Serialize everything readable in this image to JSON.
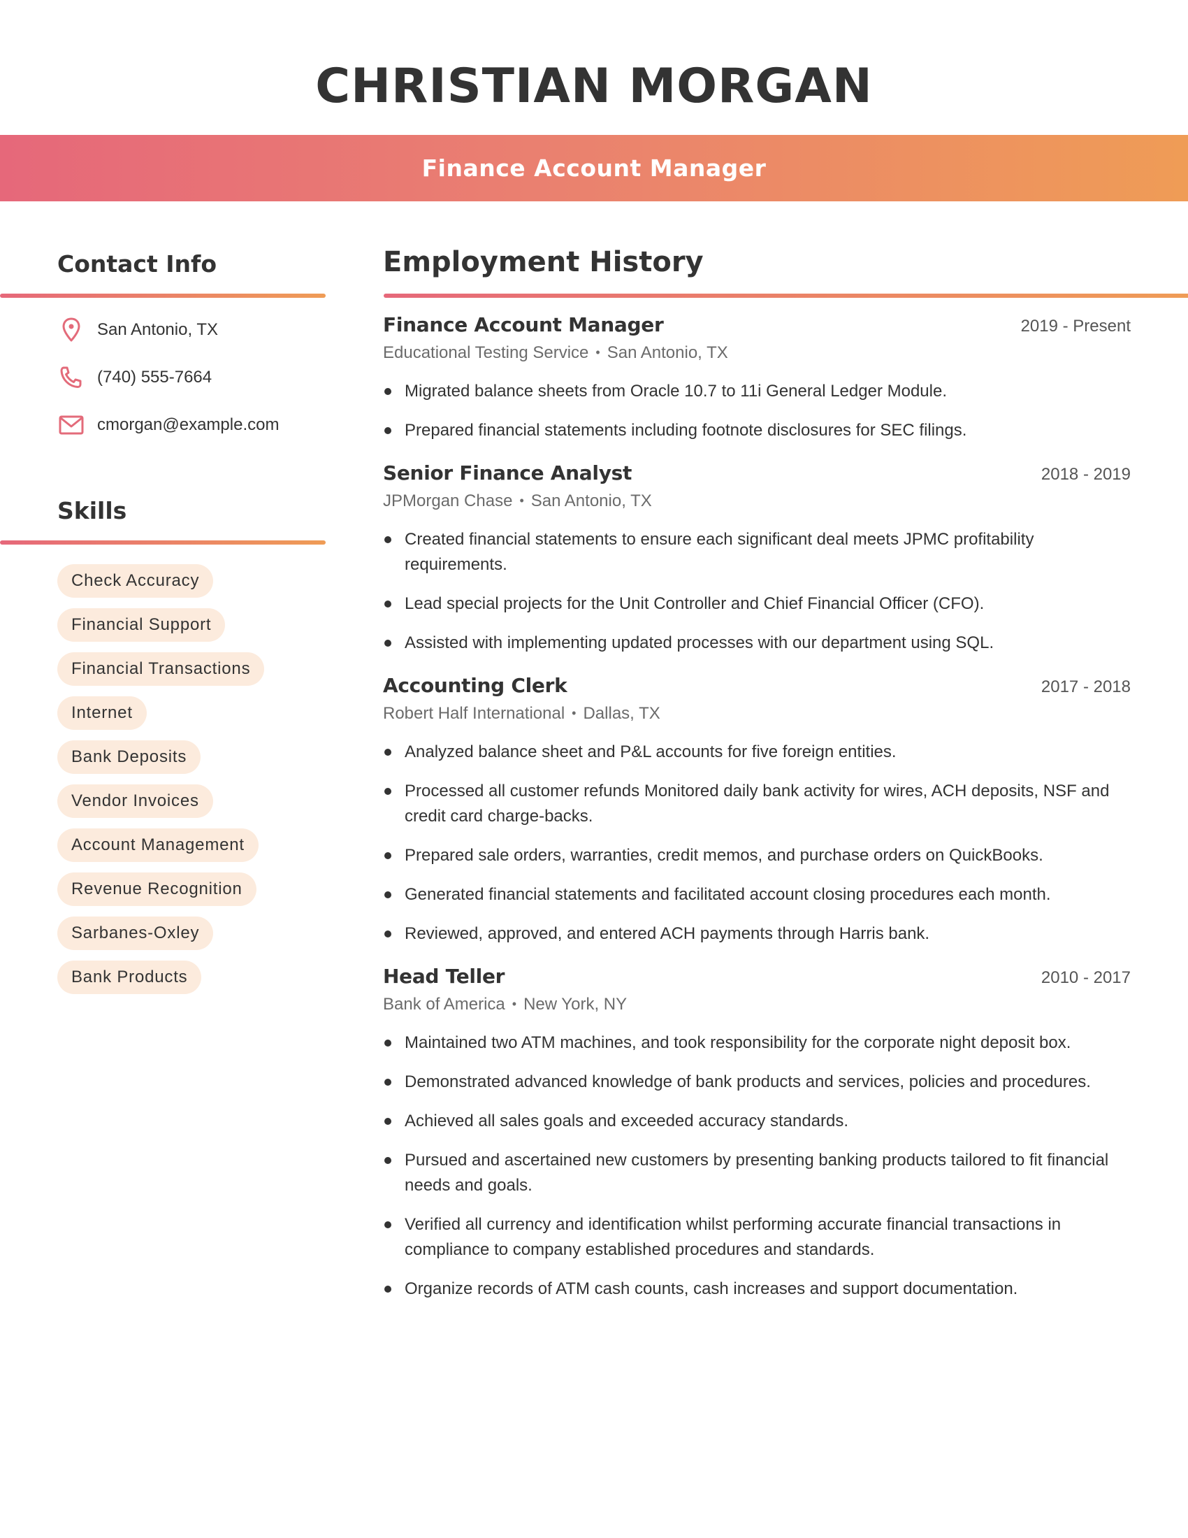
{
  "header": {
    "name": "CHRISTIAN MORGAN",
    "title": "Finance Account Manager"
  },
  "colors": {
    "gradient_start": "#e6687a",
    "gradient_end": "#ef9c56",
    "icon": "#e36b7a",
    "pill_bg": "#fcebdd",
    "text": "#333333"
  },
  "contact": {
    "heading": "Contact Info",
    "items": [
      {
        "icon": "map-pin-icon",
        "text": "San Antonio, TX"
      },
      {
        "icon": "phone-icon",
        "text": "(740) 555-7664"
      },
      {
        "icon": "mail-icon",
        "text": "cmorgan@example.com"
      }
    ]
  },
  "skills": {
    "heading": "Skills",
    "items": [
      "Check Accuracy",
      "Financial Support",
      "Financial Transactions",
      "Internet",
      "Bank Deposits",
      "Vendor Invoices",
      "Account Management",
      "Revenue Recognition",
      "Sarbanes-Oxley",
      "Bank Products"
    ]
  },
  "employment": {
    "heading": "Employment History",
    "separator": "•",
    "jobs": [
      {
        "title": "Finance Account Manager",
        "dates": "2019 - Present",
        "company": "Educational Testing Service",
        "location": "San Antonio, TX",
        "bullets": [
          "Migrated balance sheets from Oracle 10.7 to 11i General Ledger Module.",
          "Prepared financial statements including footnote disclosures for SEC filings."
        ]
      },
      {
        "title": "Senior Finance Analyst",
        "dates": "2018 - 2019",
        "company": "JPMorgan Chase",
        "location": "San Antonio, TX",
        "bullets": [
          "Created financial statements to ensure each significant deal meets JPMC profitability requirements.",
          "Lead special projects for the Unit Controller and Chief Financial Officer (CFO).",
          "Assisted with implementing updated processes with our department using SQL."
        ]
      },
      {
        "title": "Accounting Clerk",
        "dates": "2017 - 2018",
        "company": "Robert Half International",
        "location": "Dallas, TX",
        "bullets": [
          "Analyzed balance sheet and P&L accounts for five foreign entities.",
          "Processed all customer refunds Monitored daily bank activity for wires, ACH deposits, NSF and credit card charge-backs.",
          "Prepared sale orders, warranties, credit memos, and purchase orders on QuickBooks.",
          "Generated financial statements and facilitated account closing procedures each month.",
          "Reviewed, approved, and entered ACH payments through Harris bank."
        ]
      },
      {
        "title": "Head Teller",
        "dates": "2010 - 2017",
        "company": "Bank of America",
        "location": "New York, NY",
        "bullets": [
          "Maintained two ATM machines, and took responsibility for the corporate night deposit box.",
          "Demonstrated advanced knowledge of bank products and services, policies and procedures.",
          "Achieved all sales goals and exceeded accuracy standards.",
          "Pursued and ascertained new customers by presenting banking products tailored to fit financial needs and goals.",
          "Verified all currency and identification whilst performing accurate financial transactions in compliance to company established procedures and standards.",
          "Organize records of ATM cash counts, cash increases and support documentation."
        ]
      }
    ]
  }
}
